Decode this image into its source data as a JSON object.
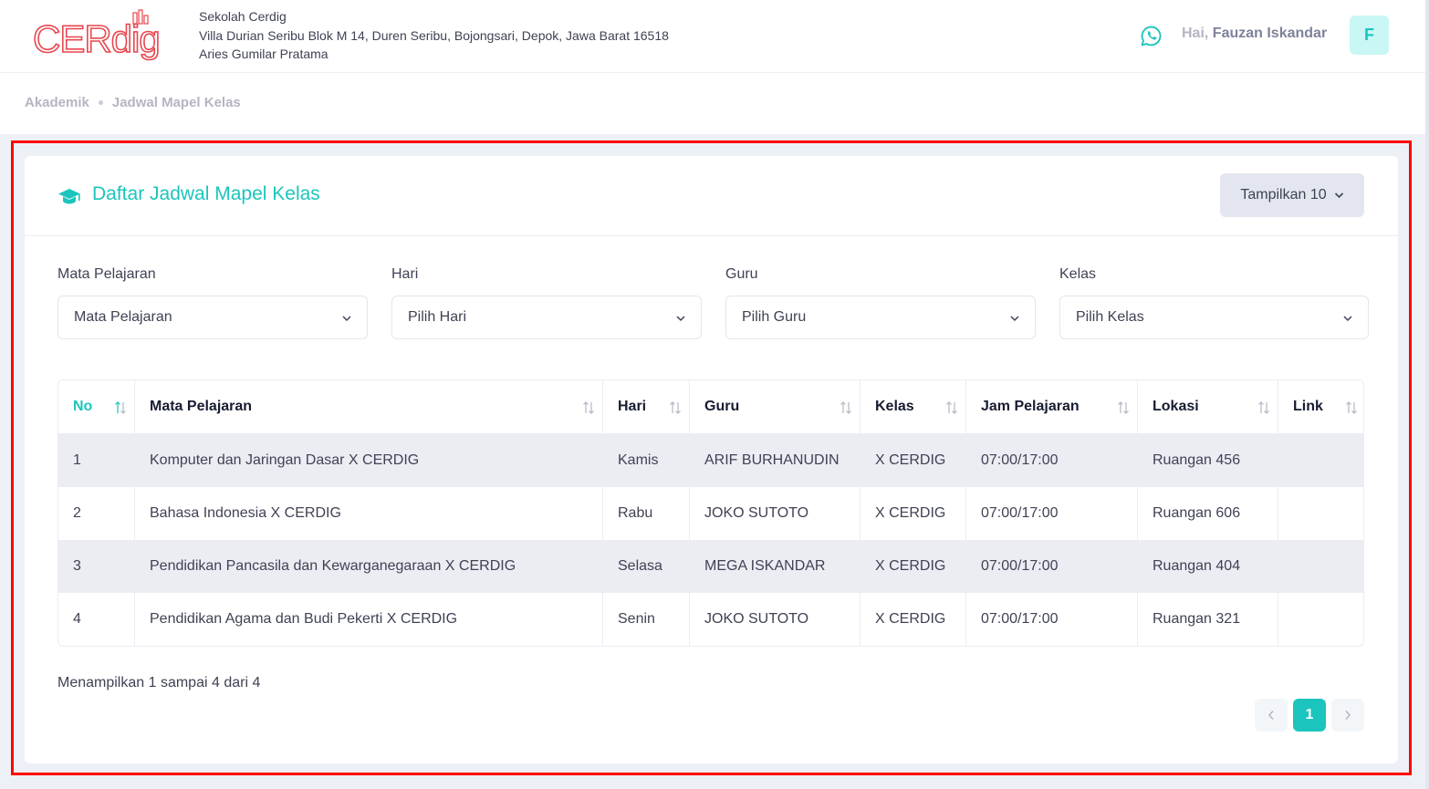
{
  "header": {
    "logo_text": "CERdig",
    "school_name": "Sekolah Cerdig",
    "school_address": "Villa Durian Seribu Blok M 14, Duren Seribu, Bojongsari, Depok, Jawa Barat 16518",
    "principal": "Aries Gumilar Pratama",
    "greeting_prefix": "Hai,",
    "user_name": "Fauzan Iskandar",
    "avatar_initial": "F",
    "icons": [
      "whatsapp-icon"
    ]
  },
  "breadcrumb": [
    "Akademik",
    "Jadwal Mapel Kelas"
  ],
  "card": {
    "title": "Daftar Jadwal Mapel Kelas",
    "title_icon": "graduation-cap-icon",
    "show_button": "Tampilkan 10"
  },
  "filters": [
    {
      "label": "Mata Pelajaran",
      "value": "Mata Pelajaran"
    },
    {
      "label": "Hari",
      "value": "Pilih Hari"
    },
    {
      "label": "Guru",
      "value": "Pilih Guru"
    },
    {
      "label": "Kelas",
      "value": "Pilih Kelas"
    }
  ],
  "table": {
    "columns": [
      "No",
      "Mata Pelajaran",
      "Hari",
      "Guru",
      "Kelas",
      "Jam Pelajaran",
      "Lokasi",
      "Link"
    ],
    "rows": [
      [
        "1",
        "Komputer dan Jaringan Dasar X CERDIG",
        "Kamis",
        "ARIF BURHANUDIN",
        "X CERDIG",
        "07:00/17:00",
        "Ruangan 456",
        ""
      ],
      [
        "2",
        "Bahasa Indonesia X CERDIG",
        "Rabu",
        "JOKO SUTOTO",
        "X CERDIG",
        "07:00/17:00",
        "Ruangan 606",
        ""
      ],
      [
        "3",
        "Pendidikan Pancasila dan Kewarganegaraan X CERDIG",
        "Selasa",
        "MEGA ISKANDAR",
        "X CERDIG",
        "07:00/17:00",
        "Ruangan 404",
        ""
      ],
      [
        "4",
        "Pendidikan Agama dan Budi Pekerti X CERDIG",
        "Senin",
        "JOKO SUTOTO",
        "X CERDIG",
        "07:00/17:00",
        "Ruangan 321",
        ""
      ]
    ]
  },
  "footer": {
    "summary": "Menampilkan 1 sampai 4 dari 4",
    "current_page": "1"
  },
  "colors": {
    "accent": "#1bc5bd",
    "logo": "#e8474f",
    "highlight": "#ff0000"
  }
}
